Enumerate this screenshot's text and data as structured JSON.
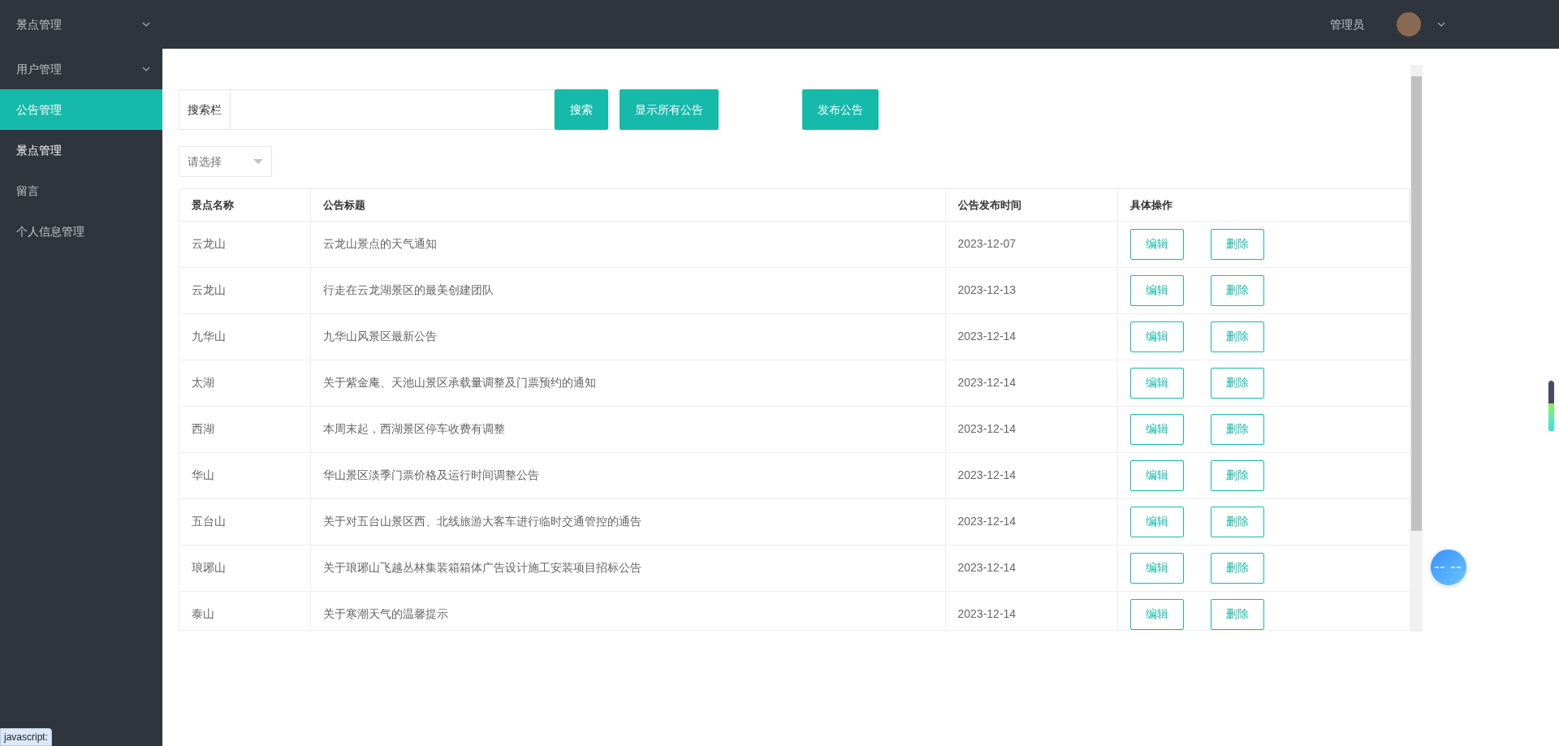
{
  "header": {
    "user": "管理员"
  },
  "sidebar": {
    "items": [
      {
        "label": "景点管理",
        "kind": "group",
        "selected": false
      },
      {
        "label": "用户管理",
        "kind": "group",
        "selected": false
      },
      {
        "label": "公告管理",
        "kind": "item",
        "selected": true
      },
      {
        "label": "景点管理",
        "kind": "item",
        "selected": false,
        "emphasis": true
      },
      {
        "label": "留言",
        "kind": "item",
        "selected": false
      },
      {
        "label": "个人信息管理",
        "kind": "item",
        "selected": false
      }
    ]
  },
  "toolbar": {
    "search_label": "搜索栏",
    "search_button": "搜索",
    "show_all_button": "显示所有公告",
    "publish_button": "发布公告"
  },
  "filter": {
    "placeholder": "请选择"
  },
  "table": {
    "columns": [
      "景点名称",
      "公告标题",
      "公告发布时间",
      "具体操作"
    ],
    "rows": [
      {
        "spot": "云龙山",
        "title": "云龙山景点的天气通知",
        "date": "2023-12-07",
        "edit": "编辑",
        "delete": "删除"
      },
      {
        "spot": "云龙山",
        "title": "行走在云龙湖景区的最美创建团队",
        "date": "2023-12-13",
        "edit": "编辑",
        "delete": "删除"
      },
      {
        "spot": "九华山",
        "title": "九华山风景区最新公告",
        "date": "2023-12-14",
        "edit": "编辑",
        "delete": "删除"
      },
      {
        "spot": "太湖",
        "title": "关于紫金庵、天池山景区承载量调整及门票预约的通知",
        "date": "2023-12-14",
        "edit": "编辑",
        "delete": "删除"
      },
      {
        "spot": "西湖",
        "title": "本周末起，西湖景区停车收费有调整",
        "date": "2023-12-14",
        "edit": "编辑",
        "delete": "删除"
      },
      {
        "spot": "华山",
        "title": "华山景区淡季门票价格及运行时间调整公告",
        "date": "2023-12-14",
        "edit": "编辑",
        "delete": "删除"
      },
      {
        "spot": "五台山",
        "title": "关于对五台山景区西、北线旅游大客车进行临时交通管控的通告",
        "date": "2023-12-14",
        "edit": "编辑",
        "delete": "删除"
      },
      {
        "spot": "琅琊山",
        "title": "关于琅琊山飞越丛林集装箱箱体广告设计施工安装项目招标公告",
        "date": "2023-12-14",
        "edit": "编辑",
        "delete": "删除"
      },
      {
        "spot": "泰山",
        "title": "关于寒潮天气的温馨提示",
        "date": "2023-12-14",
        "edit": "编辑",
        "delete": "删除"
      }
    ]
  },
  "meter": {
    "level": 0.55
  },
  "status_bar": {
    "url": "javascript:"
  }
}
